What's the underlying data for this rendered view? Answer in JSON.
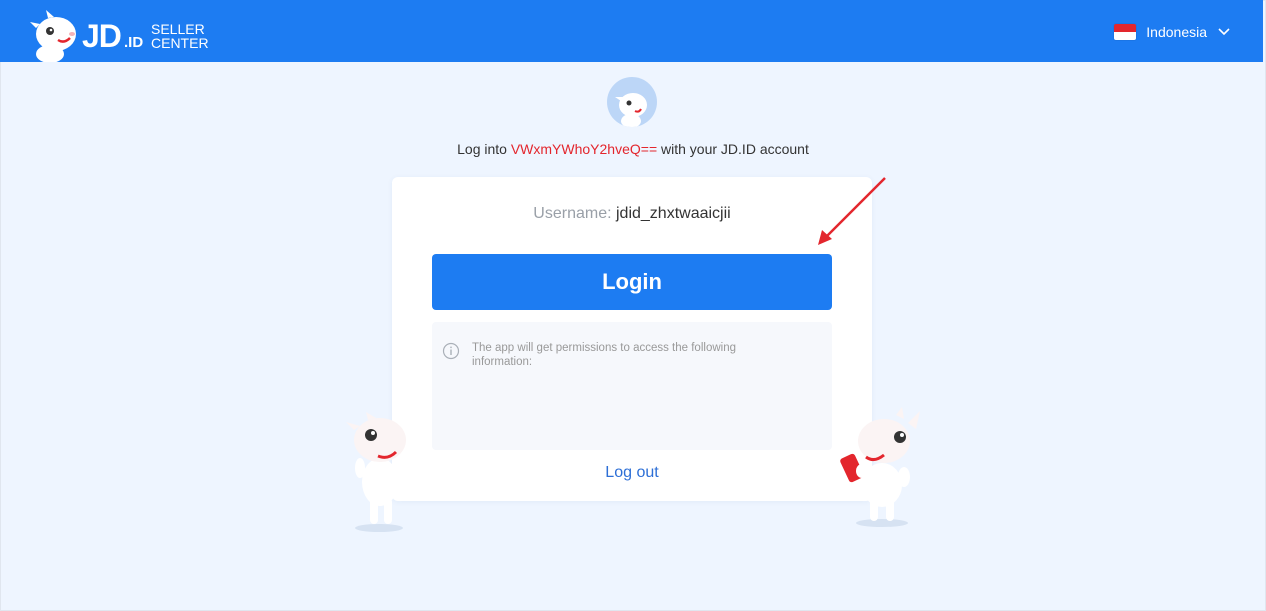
{
  "header": {
    "logo_jd": "JD",
    "logo_id": ".ID",
    "logo_seller": "SELLER",
    "logo_center": "CENTER",
    "language": "Indonesia"
  },
  "intro": {
    "prefix": "Log into ",
    "app_name": "VWxmYWhoY2hveQ==",
    "suffix": " with your JD.ID account"
  },
  "card": {
    "username_label": "Username: ",
    "username_value": "jdid_zhxtwaaicjii",
    "login_label": "Login",
    "permission_text": "The app will get permissions to access the following information:",
    "logout_label": "Log out"
  },
  "colors": {
    "brand_blue": "#1d7cf2",
    "app_name_red": "#e3262d",
    "arrow_red": "#e3262d"
  },
  "icons": [
    "jd-mascot-logo",
    "indonesia-flag-icon",
    "chevron-down-icon",
    "info-icon",
    "red-arrow-annotation"
  ]
}
